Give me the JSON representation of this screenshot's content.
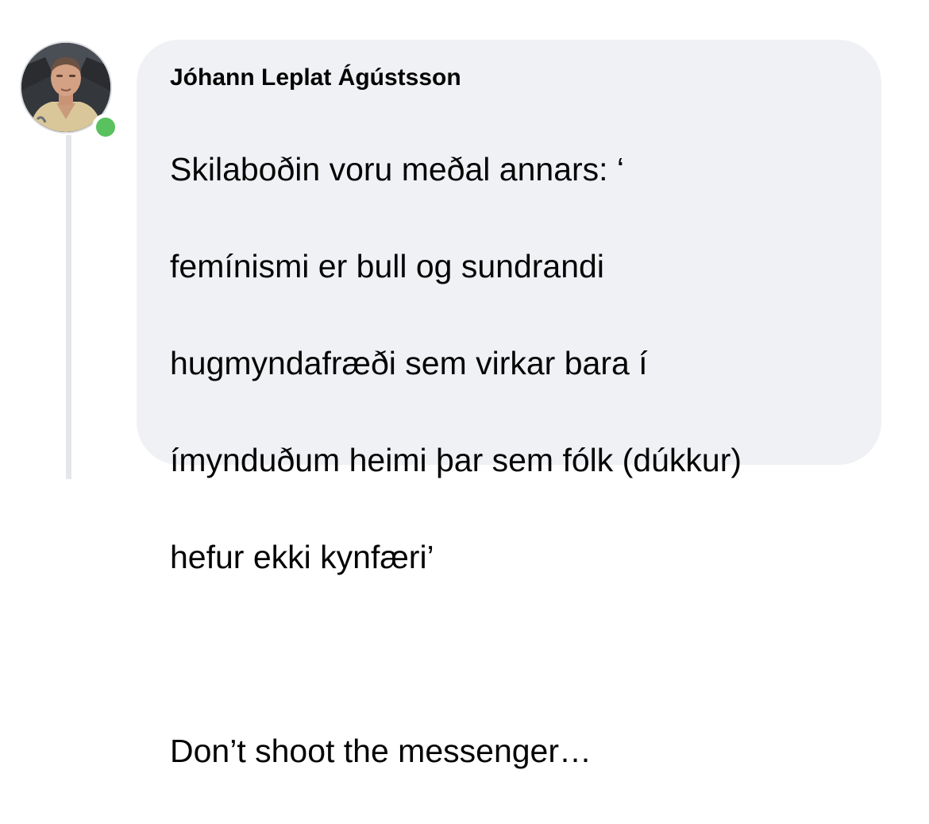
{
  "comment": {
    "author": "Jóhann Leplat Ágústsson",
    "message_lines": [
      "Skilaboðin voru meðal annars: ‘",
      "femínismi er bull og sundrandi",
      "hugmyndafræði sem virkar bara í",
      "ímynduðum heimi þar sem fólk (dúkkur)",
      "hefur ekki kynfæri’",
      "",
      "Don’t shoot the messenger…"
    ],
    "online": true
  },
  "colors": {
    "bubble_background": "#f0f1f4",
    "online_indicator": "#5ac15f",
    "thread_line": "#e4e6eb",
    "text": "#050505"
  }
}
